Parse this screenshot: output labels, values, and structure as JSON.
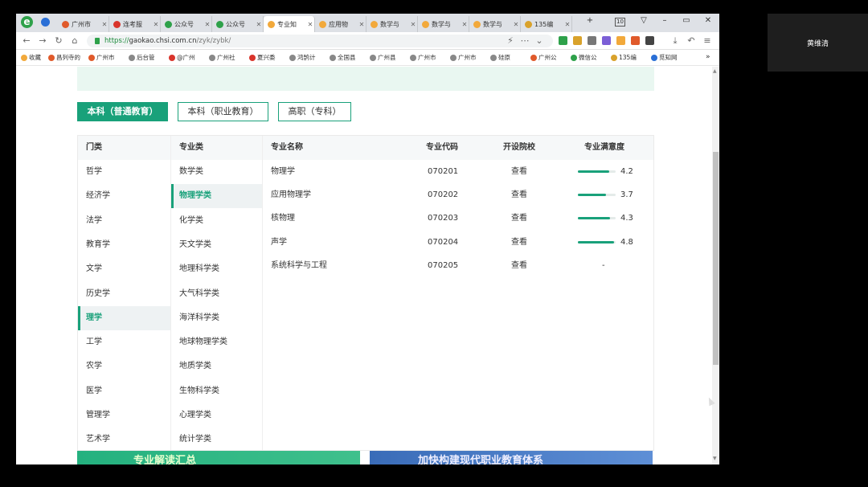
{
  "browser": {
    "tabs": [
      {
        "label": "广州市",
        "color": "#e05a2b"
      },
      {
        "label": "连考服",
        "color": "#d9342b"
      },
      {
        "label": "公众号",
        "color": "#2ea14a"
      },
      {
        "label": "公众号",
        "color": "#2ea14a"
      },
      {
        "label": "专业知",
        "color": "#f2a93b",
        "active": true
      },
      {
        "label": "应用物",
        "color": "#f2a93b"
      },
      {
        "label": "数学与",
        "color": "#f2a93b"
      },
      {
        "label": "数学与",
        "color": "#f2a93b"
      },
      {
        "label": "数学与",
        "color": "#f2a93b"
      },
      {
        "label": "135编",
        "color": "#d9a22b"
      }
    ],
    "tab_count_badge": "10",
    "url": {
      "scheme": "https://",
      "host": "gaokao.chsi.com.cn",
      "path": "/zyk/zybk/"
    },
    "bookmarks": [
      "收藏",
      "昌列寺的",
      "广州市",
      "后台管",
      "@广州",
      "广州社",
      "夏兴委",
      "鸿鹄计",
      "全国县",
      "广州县",
      "广州市",
      "广州市",
      "硅原",
      "广州公",
      "微信公",
      "135编",
      "觅知网"
    ]
  },
  "page": {
    "edu_types": [
      {
        "label": "本科（普通教育）",
        "active": true
      },
      {
        "label": "本科（职业教育）",
        "active": false
      },
      {
        "label": "高职（专科）",
        "active": false
      }
    ],
    "categories_header": "门类",
    "categories": [
      "哲学",
      "经济学",
      "法学",
      "教育学",
      "文学",
      "历史学",
      "理学",
      "工学",
      "农学",
      "医学",
      "管理学",
      "艺术学"
    ],
    "selected_category": "理学",
    "subcategories_header": "专业类",
    "subcategories": [
      "数学类",
      "物理学类",
      "化学类",
      "天文学类",
      "地理科学类",
      "大气科学类",
      "海洋科学类",
      "地球物理学类",
      "地质学类",
      "生物科学类",
      "心理学类",
      "统计学类"
    ],
    "selected_subcategory": "物理学类",
    "majors_table": {
      "headers": {
        "name": "专业名称",
        "code": "专业代码",
        "schools": "开设院校",
        "satisfaction": "专业满意度"
      },
      "rows": [
        {
          "name": "物理学",
          "code": "070201",
          "schools": "查看",
          "satisfaction": 4.2,
          "satisfaction_text": "4.2"
        },
        {
          "name": "应用物理学",
          "code": "070202",
          "schools": "查看",
          "satisfaction": 3.7,
          "satisfaction_text": "3.7"
        },
        {
          "name": "核物理",
          "code": "070203",
          "schools": "查看",
          "satisfaction": 4.3,
          "satisfaction_text": "4.3"
        },
        {
          "name": "声学",
          "code": "070204",
          "schools": "查看",
          "satisfaction": 4.8,
          "satisfaction_text": "4.8"
        },
        {
          "name": "系统科学与工程",
          "code": "070205",
          "schools": "查看",
          "satisfaction": null,
          "satisfaction_text": "-"
        }
      ],
      "satisfaction_max": 5
    },
    "banners": {
      "left": "专业解读汇总",
      "right": "加快构建现代职业教育体系"
    }
  },
  "video_call": {
    "participant_name": "黄维清"
  },
  "colors": {
    "accent": "#19a17a",
    "notice_bg": "#e9f7f1"
  }
}
